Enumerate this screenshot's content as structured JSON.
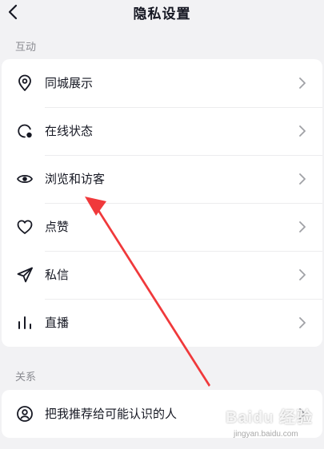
{
  "header": {
    "title": "隐私设置",
    "back_icon": "chevron-left-icon"
  },
  "sections": [
    {
      "label": "互动",
      "items": [
        {
          "label": "同城展示",
          "icon": "location-pin-icon"
        },
        {
          "label": "在线状态",
          "icon": "online-status-icon"
        },
        {
          "label": "浏览和访客",
          "icon": "eye-icon"
        },
        {
          "label": "点赞",
          "icon": "heart-icon"
        },
        {
          "label": "私信",
          "icon": "paper-plane-icon"
        },
        {
          "label": "直播",
          "icon": "bar-chart-icon"
        }
      ]
    },
    {
      "label": "关系",
      "items": [
        {
          "label": "把我推荐给可能认识的人",
          "icon": "user-circle-icon"
        }
      ]
    }
  ],
  "annotation": {
    "color": "#f0393b"
  },
  "watermark": {
    "text": "Baidu 经验",
    "sub": "jingyan.baidu.com"
  }
}
